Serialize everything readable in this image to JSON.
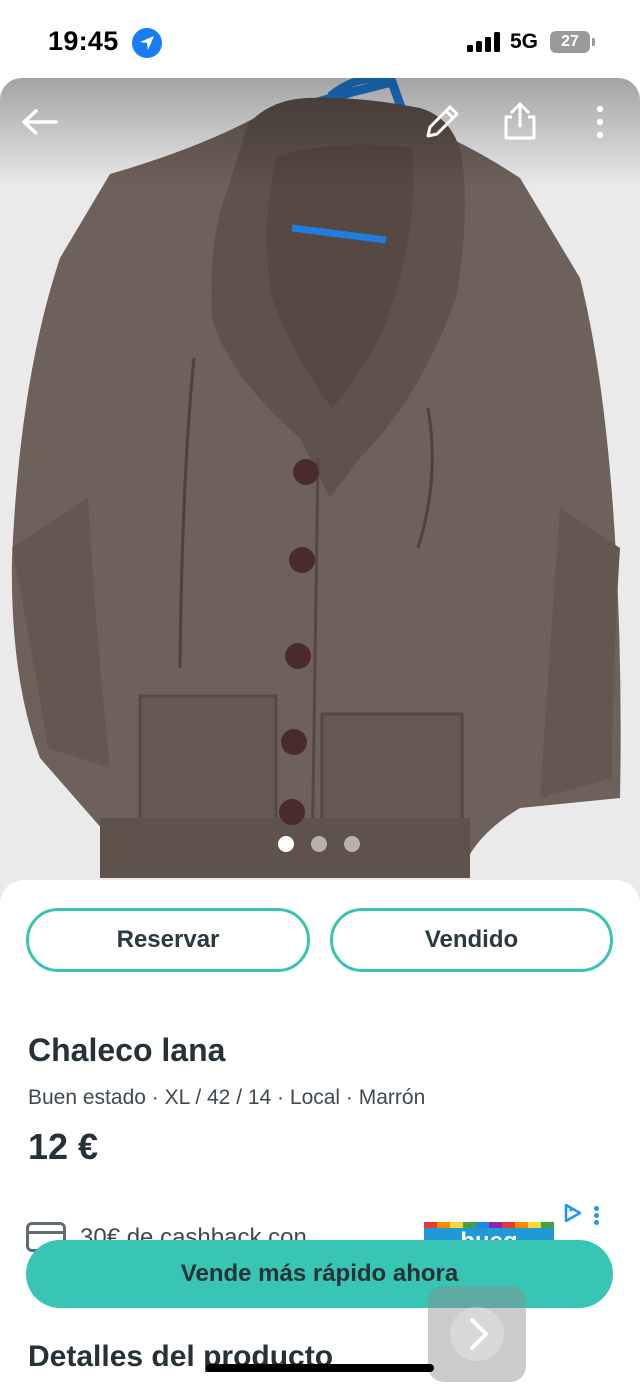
{
  "status_bar": {
    "time": "19:45",
    "network": "5G",
    "battery": "27"
  },
  "photo": {
    "icons": [
      "back-arrow-icon",
      "pencil-edit-icon",
      "share-icon",
      "more-vertical-icon"
    ],
    "carousel": {
      "total": 3,
      "active_index": 0
    }
  },
  "actions": {
    "reserve_label": "Reservar",
    "sold_label": "Vendido"
  },
  "product": {
    "title": "Chaleco lana",
    "attributes": "Buen estado · XL / 42 / 14 · Local · Marrón",
    "price": "12 €"
  },
  "promo": {
    "cashback_text": "30€ de cashback con",
    "ad_text": "bueg"
  },
  "cta": {
    "label": "Vende más rápido ahora"
  },
  "details": {
    "heading": "Detalles del producto"
  },
  "colors": {
    "accent": "#38c5b4",
    "text": "#253238",
    "garment": "#6e605a"
  }
}
